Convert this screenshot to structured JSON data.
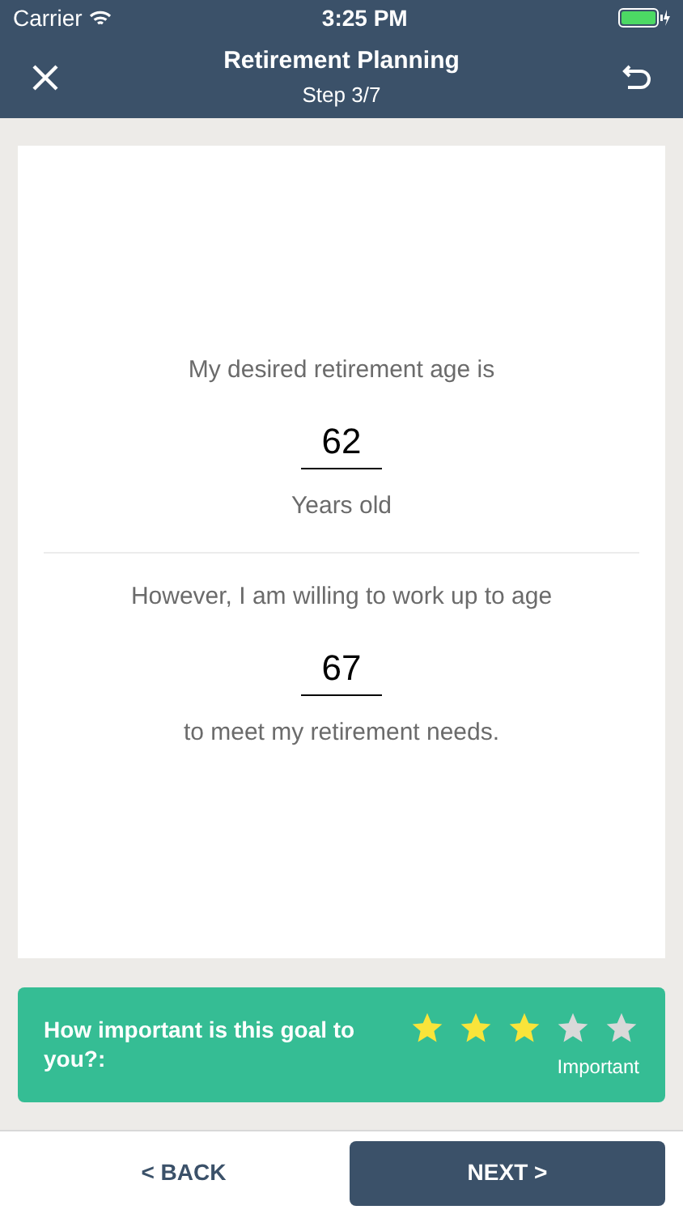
{
  "status_bar": {
    "carrier": "Carrier",
    "time": "3:25 PM"
  },
  "header": {
    "title": "Retirement Planning",
    "subtitle": "Step 3/7"
  },
  "form": {
    "desired_label": "My desired retirement age is",
    "desired_age": "62",
    "desired_unit": "Years old",
    "willing_label": "However, I am willing to work up to age",
    "willing_age": "67",
    "willing_suffix": "to meet my retirement needs."
  },
  "importance": {
    "question": "How important is this goal to you?:",
    "stars": 3,
    "rating_label": "Important"
  },
  "buttons": {
    "back": "< BACK",
    "next": "NEXT >"
  }
}
